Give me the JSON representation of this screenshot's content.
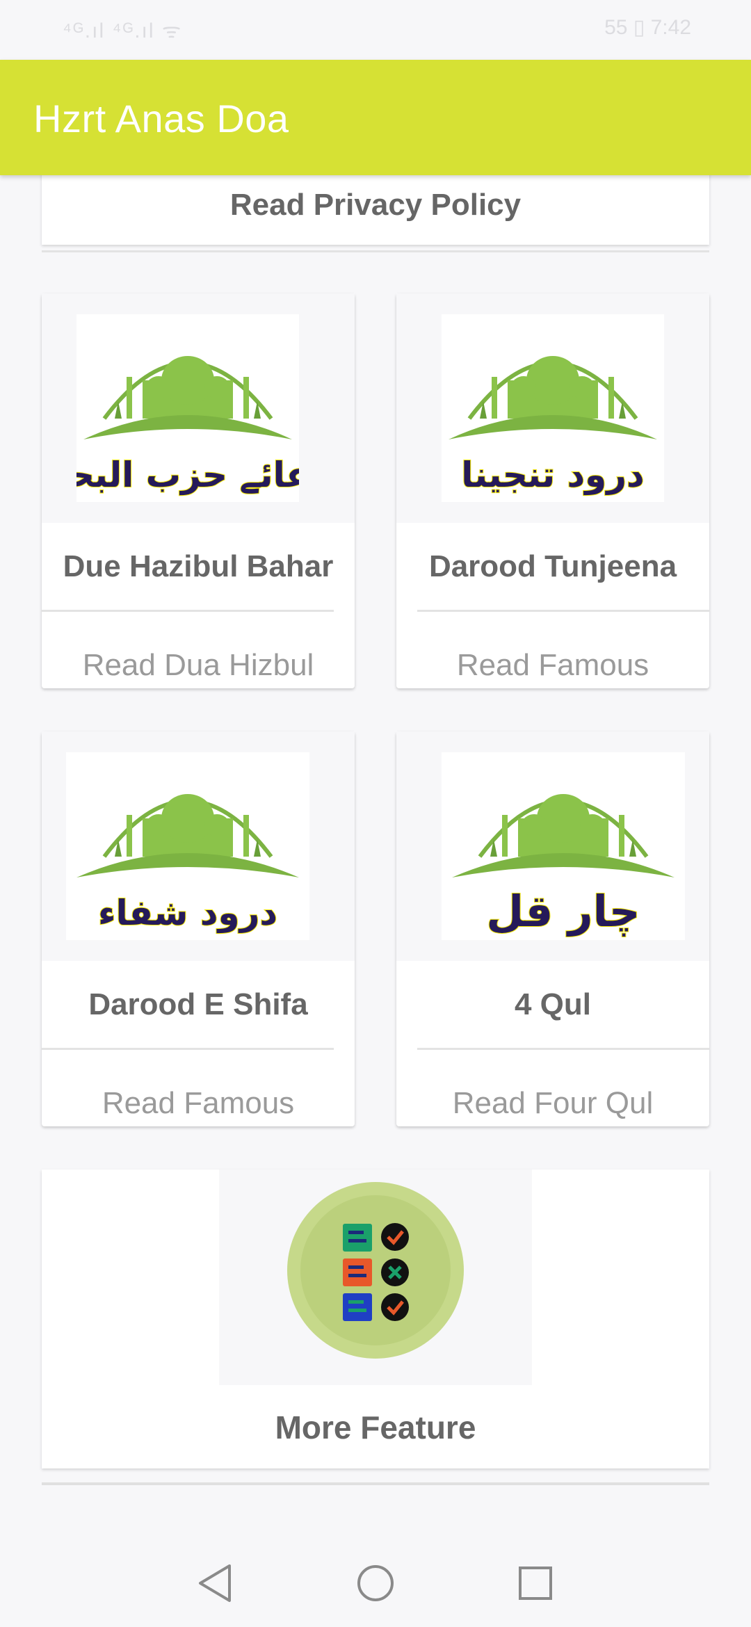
{
  "status": {
    "left": "⁴ᴳ.ıl ⁴ᴳ.ıl ᯤ",
    "right": "55 ▯ 7:42"
  },
  "app_bar": {
    "title": "Hzrt Anas Doa"
  },
  "privacy": {
    "label": "Read Privacy Policy"
  },
  "cards": [
    {
      "title": "Due Hazibul Bahar",
      "subtitle": "Read Dua Hizbul",
      "image_text": "دعائے حزب البحر"
    },
    {
      "title": "Darood Tunjeena",
      "subtitle": "Read Famous",
      "image_text": "درود تنجینا"
    },
    {
      "title": "Darood E Shifa",
      "subtitle": "Read Famous",
      "image_text": "درود شفاء"
    },
    {
      "title": "4 Qul",
      "subtitle": "Read Four Qul",
      "image_text": "چار قل"
    }
  ],
  "more": {
    "title": "More Feature"
  },
  "nav": {
    "back": "back-icon",
    "home": "home-icon",
    "recents": "recents-icon"
  },
  "colors": {
    "app_bar": "#d6e134",
    "mosque_green": "#7cb342",
    "urdu_text": "#251a5a"
  }
}
